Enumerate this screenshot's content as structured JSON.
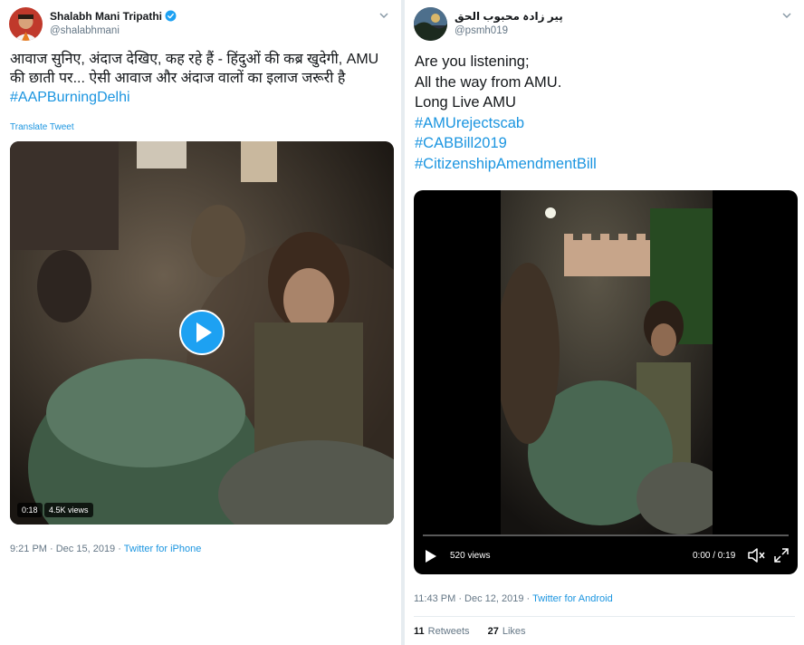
{
  "left": {
    "author_name": "Shalabh Mani Tripathi",
    "handle": "@shalabhmani",
    "text_line1": "आवाज सुनिए, अंदाज देखिए, कह रहे हैं - हिंदुओं की कब्र खुदेगी, AMU",
    "text_line2": "की छाती पर... ऐसी आवाज और अंदाज वालों का इलाज जरूरी है",
    "hashtag": "#AAPBurningDelhi",
    "translate": "Translate Tweet",
    "video_duration": "0:18",
    "video_views": "4.5K views",
    "timestamp": "9:21 PM · Dec 15, 2019 · ",
    "source": "Twitter for iPhone"
  },
  "right": {
    "author_name": "پیر زادہ محبوب الحق",
    "handle": "@psmh019",
    "lines": [
      "Are you listening;",
      "All the way from AMU.",
      "Long Live AMU"
    ],
    "hashtags": [
      "#AMUrejectscab",
      "#CABBill2019",
      "#CitizenshipAmendmentBill"
    ],
    "video_views": "520 views",
    "video_time": "0:00 / 0:19",
    "video_progress": 0,
    "timestamp": "11:43 PM · Dec 12, 2019 · ",
    "source": "Twitter for Android",
    "retweets_count": "11",
    "retweets_label": "Retweets",
    "likes_count": "27",
    "likes_label": "Likes"
  },
  "colors": {
    "link": "#1b95e0",
    "verified": "#1da1f2",
    "play": "#1da1f2"
  }
}
